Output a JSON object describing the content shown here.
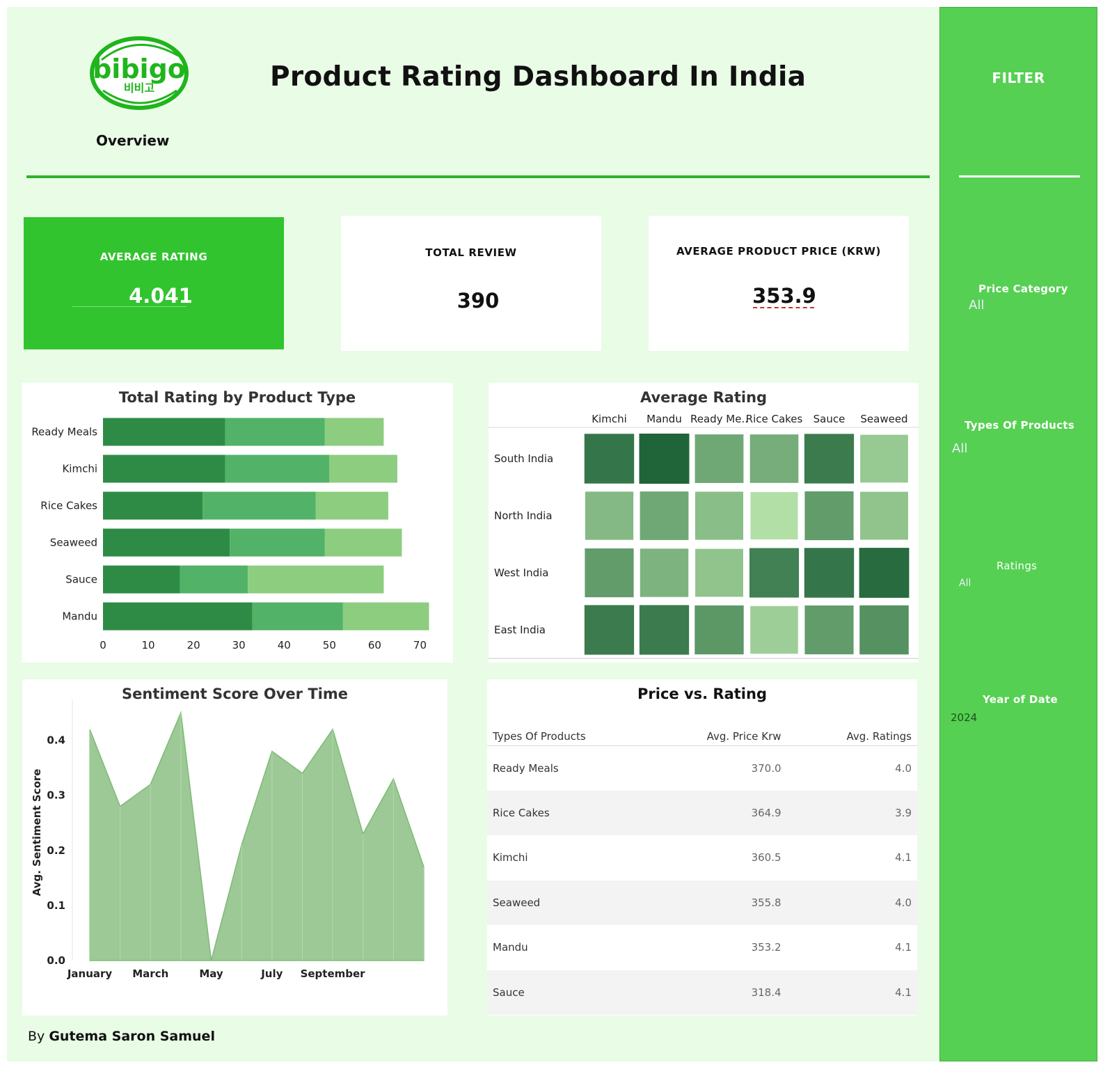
{
  "header": {
    "logo_text": "bibigo",
    "logo_sub": "비비고",
    "title": "Product Rating Dashboard In India",
    "subtitle": "Overview"
  },
  "kpis": {
    "avg_rating": {
      "label": "AVERAGE RATING",
      "value": "4.041"
    },
    "total_review": {
      "label": "TOTAL REVIEW",
      "value": "390"
    },
    "avg_price": {
      "label": "AVERAGE  PRODUCT PRICE (KRW)",
      "value": "353.9"
    }
  },
  "colors": {
    "accent": "#31c42f",
    "sidebar": "#55d052",
    "background": "#e9fce6",
    "bar_dark": "#2e8b45",
    "bar_mid": "#52b267",
    "bar_light": "#8ccd7f",
    "area_fill": "#9cc995"
  },
  "bar_chart": {
    "title": "Total Rating by Product Type",
    "chart_data": {
      "type": "bar",
      "orientation": "horizontal",
      "stacked": true,
      "categories": [
        "Ready Meals",
        "Kimchi",
        "Rice Cakes",
        "Seaweed",
        "Sauce",
        "Mandu"
      ],
      "series": [
        {
          "values": [
            27,
            27,
            22,
            28,
            17,
            33
          ]
        },
        {
          "values": [
            22,
            23,
            25,
            21,
            15,
            20
          ]
        },
        {
          "values": [
            13,
            15,
            16,
            17,
            30,
            19
          ]
        }
      ],
      "xlim": [
        0,
        75
      ],
      "xticks": [
        "0",
        "10",
        "20",
        "30",
        "40",
        "50",
        "60",
        "70"
      ],
      "grid": false
    }
  },
  "heatmap": {
    "title": "Average Rating",
    "chart_data": {
      "type": "heatmap",
      "columns": [
        "Kimchi",
        "Mandu",
        "Ready Me..",
        "Rice Cakes",
        "Sauce",
        "Seaweed"
      ],
      "rows": [
        "South India",
        "North India",
        "West India",
        "East India"
      ],
      "values": [
        [
          4.6,
          4.9,
          3.7,
          3.6,
          4.5,
          3.1
        ],
        [
          3.4,
          3.7,
          3.3,
          2.7,
          3.9,
          3.2
        ],
        [
          3.9,
          3.5,
          3.2,
          4.4,
          4.6,
          4.8
        ],
        [
          4.5,
          4.5,
          4.0,
          3.0,
          3.9,
          4.1
        ]
      ]
    }
  },
  "area_chart": {
    "title": "Sentiment Score Over Time",
    "chart_data": {
      "type": "area",
      "x": [
        "January",
        "February",
        "March",
        "April",
        "May",
        "June",
        "July",
        "August",
        "September",
        "October",
        "November",
        "December"
      ],
      "values": [
        0.42,
        0.28,
        0.32,
        0.45,
        0.0,
        0.21,
        0.38,
        0.34,
        0.42,
        0.23,
        0.33,
        0.17
      ],
      "xtick_labels": [
        "January",
        "March",
        "May",
        "July",
        "September"
      ],
      "ylabel": "Avg. Sentiment Score",
      "ylim": [
        0,
        0.45
      ],
      "yticks": [
        "0.0",
        "0.1",
        "0.2",
        "0.3",
        "0.4"
      ]
    }
  },
  "price_table": {
    "title": "Price vs. Rating",
    "columns": [
      "Types Of Products",
      "Avg. Price Krw",
      "Avg. Ratings"
    ],
    "rows": [
      {
        "type": "Ready Meals",
        "price": "370.0",
        "rating": "4.0"
      },
      {
        "type": "Rice Cakes",
        "price": "364.9",
        "rating": "3.9"
      },
      {
        "type": "Kimchi",
        "price": "360.5",
        "rating": "4.1"
      },
      {
        "type": "Seaweed",
        "price": "355.8",
        "rating": "4.0"
      },
      {
        "type": "Mandu",
        "price": "353.2",
        "rating": "4.1"
      },
      {
        "type": "Sauce",
        "price": "318.4",
        "rating": "4.1"
      }
    ]
  },
  "sidebar": {
    "title": "FILTER",
    "filters": [
      {
        "label": "Price Category",
        "value": "All"
      },
      {
        "label": "Types Of Products",
        "value": "All"
      },
      {
        "label": "Ratings",
        "value": "All"
      },
      {
        "label": "Year of Date",
        "value": "2024"
      }
    ]
  },
  "footer": {
    "by": "By",
    "author": "Gutema Saron Samuel"
  }
}
